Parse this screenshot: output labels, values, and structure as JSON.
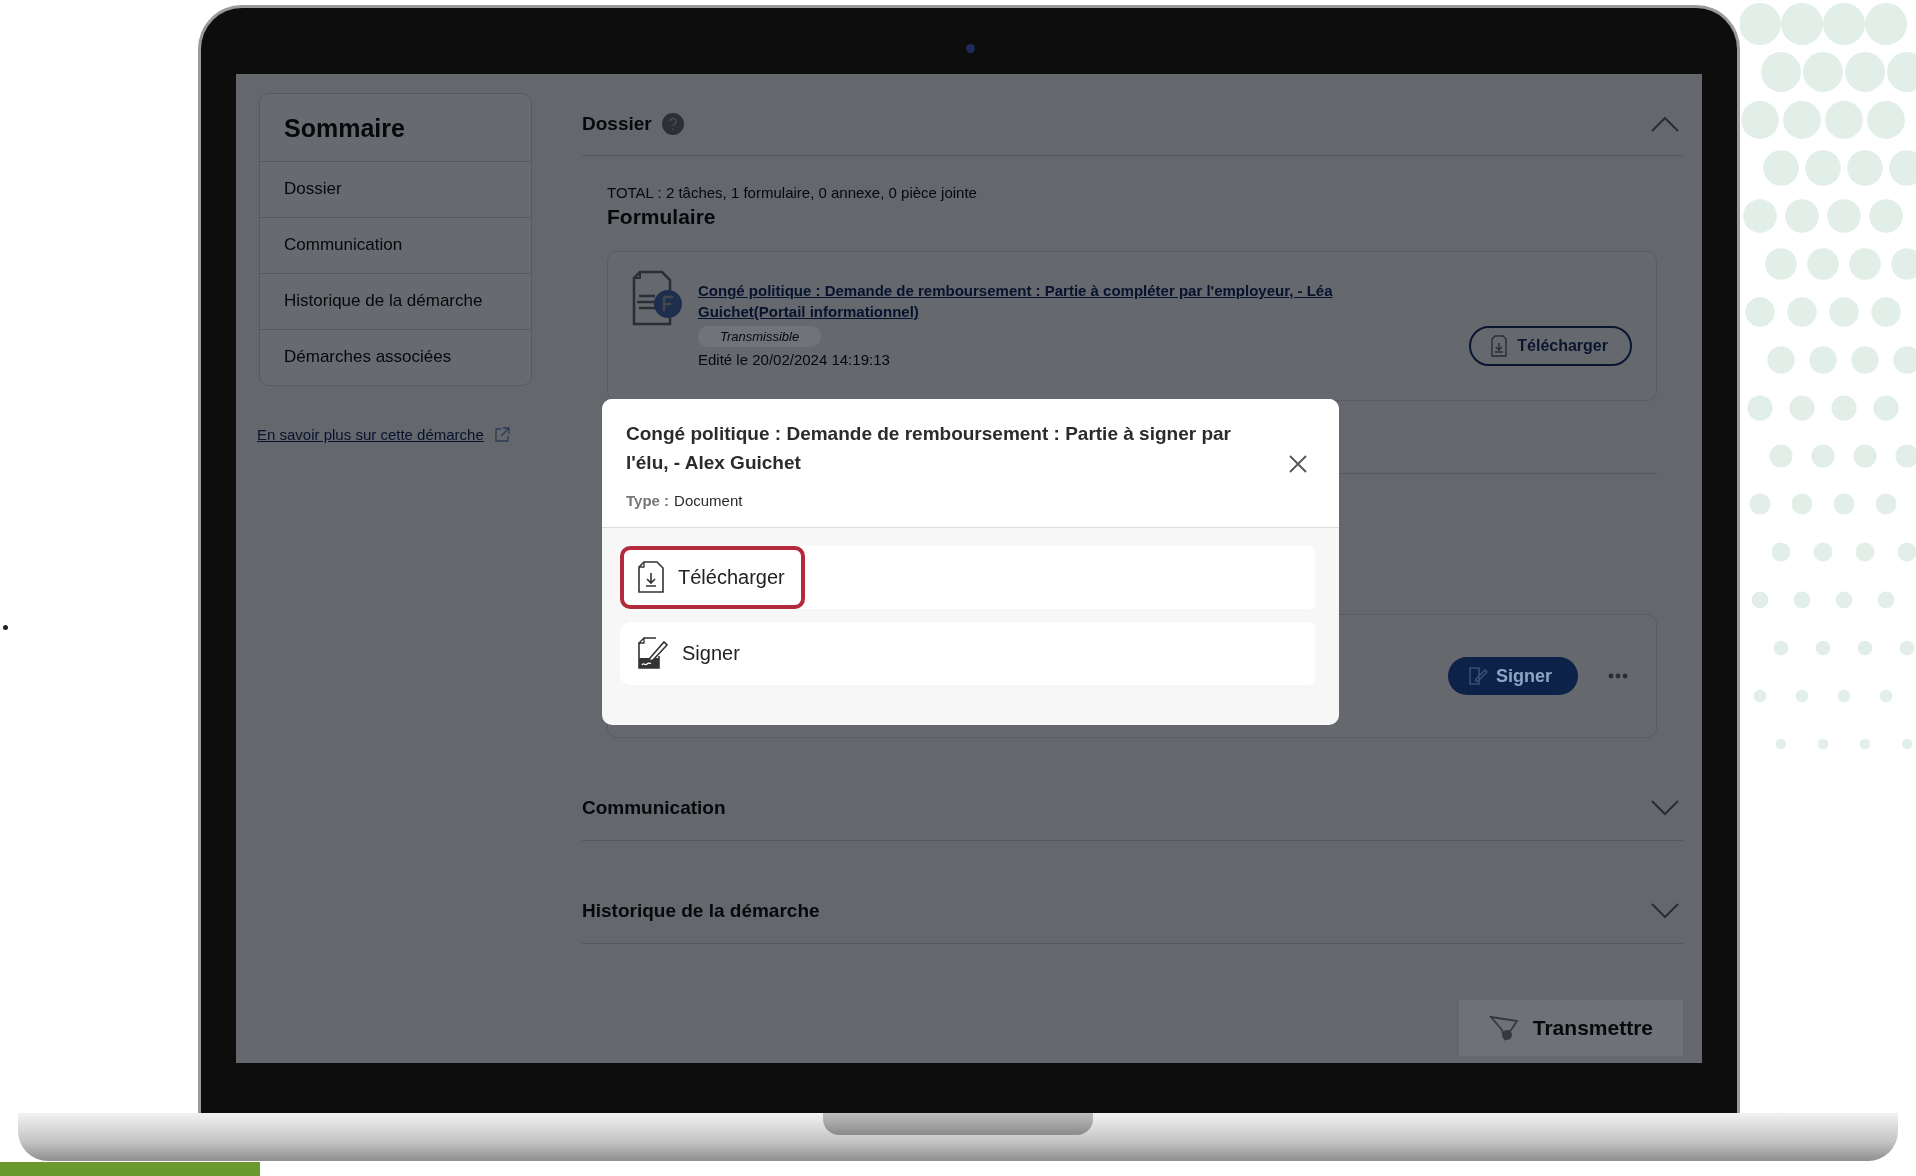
{
  "sidebar": {
    "title": "Sommaire",
    "items": [
      "Dossier",
      "Communication",
      "Historique de la démarche",
      "Démarches associées"
    ]
  },
  "learn_more_link": "En savoir plus sur cette démarche",
  "dossier": {
    "title": "Dossier",
    "expanded": true,
    "total": "TOTAL : 2 tâches, 1 formulaire, 0 annexe, 0 pièce jointe",
    "section_title": "Formulaire",
    "form": {
      "title": "Congé politique : Demande de remboursement : Partie à compléter par l'employeur, - Léa Guichet(Portail informationnel)",
      "tag": "Transmissible",
      "edited": "Edité le 20/02/2024 14:19:13",
      "download_button": "Télécharger"
    },
    "task": {
      "sign_button": "Signer"
    }
  },
  "sections": [
    {
      "title": "Communication",
      "expanded": false
    },
    {
      "title": "Historique de la démarche",
      "expanded": false
    }
  ],
  "transmit_button": "Transmettre",
  "modal": {
    "title": "Congé politique : Demande de remboursement : Partie à signer par l'élu, - Alex Guichet",
    "type_label": "Type :",
    "type_value": "Document",
    "options": [
      {
        "kind": "download",
        "label": "Télécharger",
        "highlighted": true
      },
      {
        "kind": "sign",
        "label": "Signer",
        "highlighted": false
      }
    ]
  }
}
